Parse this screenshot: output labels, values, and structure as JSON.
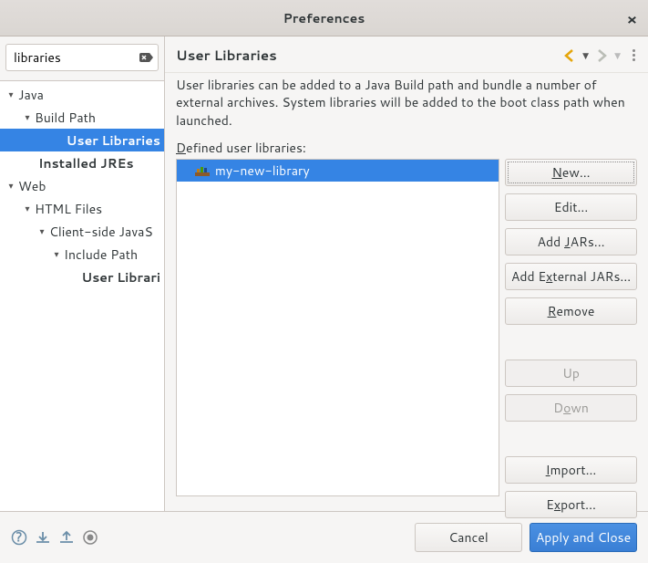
{
  "window": {
    "title": "Preferences"
  },
  "search": {
    "value": "libraries"
  },
  "tree": {
    "java": "Java",
    "buildPath": "Build Path",
    "userLibraries": "User Libraries",
    "installedJres": "Installed JREs",
    "web": "Web",
    "htmlFiles": "HTML Files",
    "clientSideJs": "Client-side JavaS",
    "includePath": "Include Path",
    "webUserLibraries": "User Librari"
  },
  "page": {
    "title": "User Libraries",
    "desc": "User libraries can be added to a Java Build path and bundle a number of external archives. System libraries will be added to the boot class path when launched.",
    "definedLabelPre": "D",
    "definedLabelRest": "efined user libraries:",
    "items": [
      {
        "name": "my-new-library",
        "selected": true
      }
    ]
  },
  "buttons": {
    "new": "New...",
    "edit": "Edit...",
    "addJars": "Add JARs...",
    "addExternalPre": "Add E",
    "addExternalMid": "x",
    "addExternalPost": "ternal JARs...",
    "remove": "Remove",
    "up": "Up",
    "down": "Down",
    "import": "Import...",
    "export": "Export...",
    "cancel": "Cancel",
    "applyClose": "Apply and Close"
  }
}
